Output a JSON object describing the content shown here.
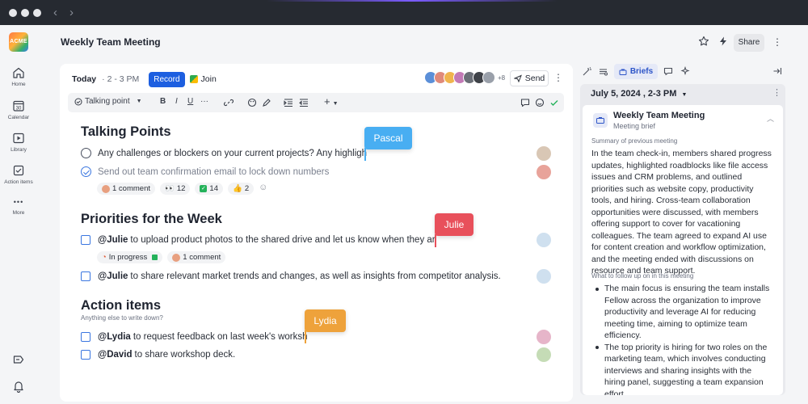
{
  "window": {
    "back_glyph": "‹",
    "forward_glyph": "›"
  },
  "app": {
    "logo_text": "ACME"
  },
  "sidebar": {
    "items": [
      {
        "label": "Home",
        "icon": "home-icon"
      },
      {
        "label": "Calendar",
        "icon": "calendar-icon"
      },
      {
        "label": "Library",
        "icon": "library-icon"
      },
      {
        "label": "Action items",
        "icon": "action-items-icon"
      },
      {
        "label": "More",
        "icon": "more-icon"
      }
    ],
    "calendar_day": "30",
    "more_glyph": "•••"
  },
  "header": {
    "title": "Weekly Team Meeting",
    "share_label": "Share",
    "kebab": "⋮"
  },
  "meeting": {
    "day": "Today",
    "time": "2 - 3 PM",
    "record_label": "Record",
    "join_label": "Join",
    "attendee_more": "+8",
    "send_label": "Send",
    "kebab": "⋮"
  },
  "toolbar": {
    "style_label": "Talking point",
    "bold": "B",
    "italic": "I",
    "underline": "U",
    "more": "···",
    "add": "+"
  },
  "sections": {
    "talking_points": {
      "title": "Talking Points",
      "items": [
        {
          "text": "Any challenges or blockers on your current projects? Any highligh",
          "done": false
        },
        {
          "text": "Send out team confirmation email to lock down numbers",
          "done": true
        }
      ],
      "reactions": {
        "comments": "1 comment",
        "eyes": "12",
        "check": "14",
        "thumbs": "2"
      }
    },
    "priorities": {
      "title": "Priorities for the Week",
      "items": [
        {
          "mention": "@Julie",
          "text": "to upload product photos to the shared drive and let us know when they ar"
        },
        {
          "mention": "@Julie",
          "text": "to share relevant market trends and changes, as well as insights from competitor analysis."
        }
      ],
      "status": "In progress",
      "comments": "1 comment"
    },
    "action_items": {
      "title": "Action items",
      "subtitle": "Anything else to write down?",
      "items": [
        {
          "mention": "@Lydia",
          "text": "to request feedback on last week's worksh"
        },
        {
          "mention": "@David",
          "text": "to share workshop deck."
        }
      ]
    }
  },
  "cursors": [
    {
      "name": "Pascal",
      "color": "#48aef2"
    },
    {
      "name": "Julie",
      "color": "#e8505b"
    },
    {
      "name": "Lydia",
      "color": "#eea23b"
    }
  ],
  "panel": {
    "active_tab": "Briefs",
    "date": "July 5, 2024 , 2-3 PM",
    "kebab": "⋮",
    "brief": {
      "title": "Weekly Team Meeting",
      "subtitle": "Meeting brief",
      "summary_label": "Summary of previous meeting",
      "summary": "In the team check-in, members shared progress updates, highlighted roadblocks like file access issues and CRM problems, and outlined priorities such as website copy, productivity tools, and hiring. Cross-team collaboration opportunities were discussed, with members offering support to cover for vacationing colleagues. The team agreed to expand AI use for content creation and workflow optimization, and the meeting ended with discussions on resource and team support.",
      "followup_label": "What to follow up on in this meeting",
      "followups": [
        "The main focus is ensuring the team installs Fellow across the organization to improve productivity and leverage AI for reducing meeting time, aiming to optimize team efficiency.",
        "The top priority is hiring for two roles on the marketing team, which involves conducting interviews and sharing insights with the hiring panel, suggesting a team expansion effort."
      ]
    }
  },
  "colors": {
    "accent": "#1d5fe0",
    "pascal": "#48aef2",
    "julie": "#e8505b",
    "lydia": "#eea23b"
  }
}
